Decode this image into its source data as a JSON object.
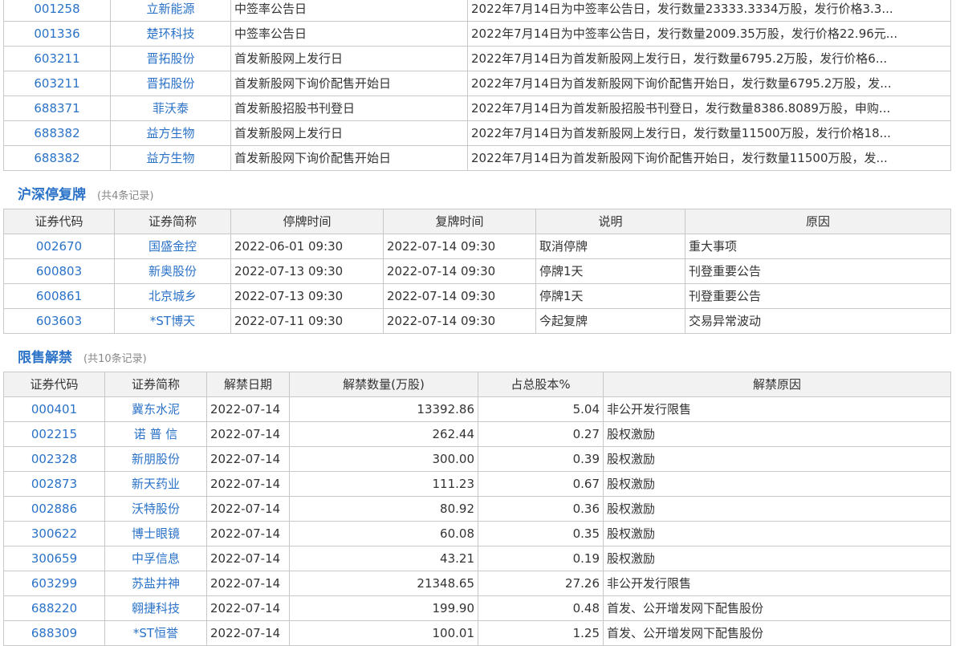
{
  "ipo_rows": [
    {
      "code": "001258",
      "name": "立新能源",
      "event": "中签率公告日",
      "desc": "2022年7月14日为中签率公告日，发行数量23333.3334万股，发行价格3.3..."
    },
    {
      "code": "001336",
      "name": "楚环科技",
      "event": "中签率公告日",
      "desc": "2022年7月14日为中签率公告日，发行数量2009.35万股，发行价格22.96元..."
    },
    {
      "code": "603211",
      "name": "晋拓股份",
      "event": "首发新股网上发行日",
      "desc": "2022年7月14日为首发新股网上发行日，发行数量6795.2万股，发行价格6..."
    },
    {
      "code": "603211",
      "name": "晋拓股份",
      "event": "首发新股网下询价配售开始日",
      "desc": "2022年7月14日为首发新股网下询价配售开始日，发行数量6795.2万股，发..."
    },
    {
      "code": "688371",
      "name": "菲沃泰",
      "event": "首发新股招股书刊登日",
      "desc": "2022年7月14日为首发新股招股书刊登日，发行数量8386.8089万股，申购..."
    },
    {
      "code": "688382",
      "name": "益方生物",
      "event": "首发新股网上发行日",
      "desc": "2022年7月14日为首发新股网上发行日，发行数量11500万股，发行价格18..."
    },
    {
      "code": "688382",
      "name": "益方生物",
      "event": "首发新股网下询价配售开始日",
      "desc": "2022年7月14日为首发新股网下询价配售开始日，发行数量11500万股，发..."
    }
  ],
  "suspension": {
    "title": "沪深停复牌",
    "count": "(共4条记录)",
    "headers": [
      "证券代码",
      "证券简称",
      "停牌时间",
      "复牌时间",
      "说明",
      "原因"
    ],
    "rows": [
      {
        "code": "002670",
        "name": "国盛金控",
        "stop": "2022-06-01 09:30",
        "resume": "2022-07-14 09:30",
        "note": "取消停牌",
        "reason": "重大事项"
      },
      {
        "code": "600803",
        "name": "新奥股份",
        "stop": "2022-07-13 09:30",
        "resume": "2022-07-14 09:30",
        "note": "停牌1天",
        "reason": "刊登重要公告"
      },
      {
        "code": "600861",
        "name": "北京城乡",
        "stop": "2022-07-13 09:30",
        "resume": "2022-07-14 09:30",
        "note": "停牌1天",
        "reason": "刊登重要公告"
      },
      {
        "code": "603603",
        "name": "*ST博天",
        "stop": "2022-07-11 09:30",
        "resume": "2022-07-14 09:30",
        "note": "今起复牌",
        "reason": "交易异常波动"
      }
    ]
  },
  "unlock": {
    "title": "限售解禁",
    "count": "(共10条记录)",
    "headers": [
      "证券代码",
      "证券简称",
      "解禁日期",
      "解禁数量(万股)",
      "占总股本%",
      "解禁原因"
    ],
    "rows": [
      {
        "code": "000401",
        "name": "冀东水泥",
        "date": "2022-07-14",
        "qty": "13392.86",
        "pct": "5.04",
        "reason": "非公开发行限售"
      },
      {
        "code": "002215",
        "name": "诺 普 信",
        "date": "2022-07-14",
        "qty": "262.44",
        "pct": "0.27",
        "reason": "股权激励"
      },
      {
        "code": "002328",
        "name": "新朋股份",
        "date": "2022-07-14",
        "qty": "300.00",
        "pct": "0.39",
        "reason": "股权激励"
      },
      {
        "code": "002873",
        "name": "新天药业",
        "date": "2022-07-14",
        "qty": "111.23",
        "pct": "0.67",
        "reason": "股权激励"
      },
      {
        "code": "002886",
        "name": "沃特股份",
        "date": "2022-07-14",
        "qty": "80.92",
        "pct": "0.36",
        "reason": "股权激励"
      },
      {
        "code": "300622",
        "name": "博士眼镜",
        "date": "2022-07-14",
        "qty": "60.08",
        "pct": "0.35",
        "reason": "股权激励"
      },
      {
        "code": "300659",
        "name": "中孚信息",
        "date": "2022-07-14",
        "qty": "43.21",
        "pct": "0.19",
        "reason": "股权激励"
      },
      {
        "code": "603299",
        "name": "苏盐井神",
        "date": "2022-07-14",
        "qty": "21348.65",
        "pct": "27.26",
        "reason": "非公开发行限售"
      },
      {
        "code": "688220",
        "name": "翱捷科技",
        "date": "2022-07-14",
        "qty": "199.90",
        "pct": "0.48",
        "reason": "首发、公开增发网下配售股份"
      },
      {
        "code": "688309",
        "name": "*ST恒誉",
        "date": "2022-07-14",
        "qty": "100.01",
        "pct": "1.25",
        "reason": "首发、公开增发网下配售股份"
      }
    ]
  }
}
